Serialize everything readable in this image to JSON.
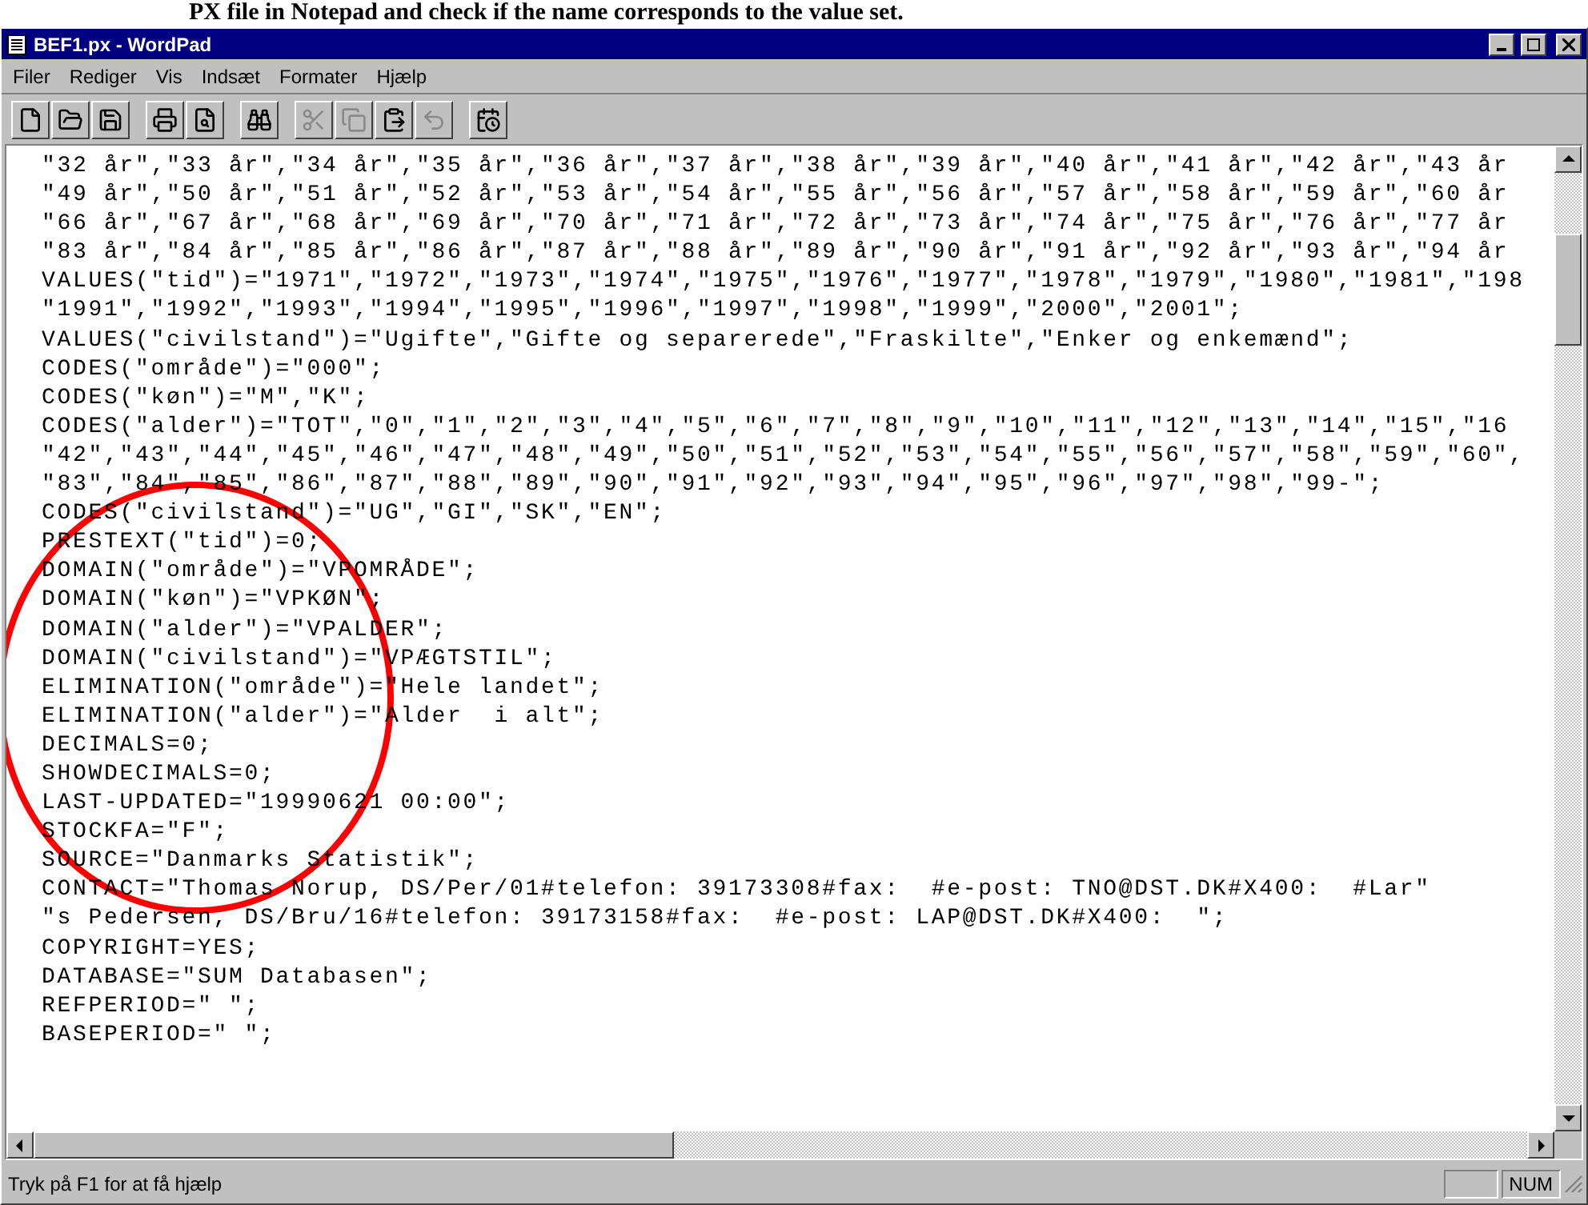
{
  "caption": "PX file in Notepad and check if the name corresponds to the value set.",
  "window": {
    "title": "BEF1.px - WordPad"
  },
  "menu": [
    {
      "label": "Filer"
    },
    {
      "label": "Rediger"
    },
    {
      "label": "Vis"
    },
    {
      "label": "Indsæt"
    },
    {
      "label": "Formater"
    },
    {
      "label": "Hjælp"
    }
  ],
  "toolbar": [
    {
      "kind": "new",
      "disabled": false
    },
    {
      "kind": "open",
      "disabled": false
    },
    {
      "kind": "save",
      "disabled": false
    },
    {
      "kind": "sep"
    },
    {
      "kind": "print",
      "disabled": false
    },
    {
      "kind": "preview",
      "disabled": false
    },
    {
      "kind": "sep"
    },
    {
      "kind": "find",
      "disabled": false
    },
    {
      "kind": "sep"
    },
    {
      "kind": "cut",
      "disabled": true
    },
    {
      "kind": "copy",
      "disabled": true
    },
    {
      "kind": "paste",
      "disabled": false
    },
    {
      "kind": "undo",
      "disabled": true
    },
    {
      "kind": "sep"
    },
    {
      "kind": "datetime",
      "disabled": false
    }
  ],
  "document": {
    "lines": [
      "\"32 år\",\"33 år\",\"34 år\",\"35 år\",\"36 år\",\"37 år\",\"38 år\",\"39 år\",\"40 år\",\"41 år\",\"42 år\",\"43 år",
      "\"49 år\",\"50 år\",\"51 år\",\"52 år\",\"53 år\",\"54 år\",\"55 år\",\"56 år\",\"57 år\",\"58 år\",\"59 år\",\"60 år",
      "\"66 år\",\"67 år\",\"68 år\",\"69 år\",\"70 år\",\"71 år\",\"72 år\",\"73 år\",\"74 år\",\"75 år\",\"76 år\",\"77 år",
      "\"83 år\",\"84 år\",\"85 år\",\"86 år\",\"87 år\",\"88 år\",\"89 år\",\"90 år\",\"91 år\",\"92 år\",\"93 år\",\"94 år",
      "VALUES(\"tid\")=\"1971\",\"1972\",\"1973\",\"1974\",\"1975\",\"1976\",\"1977\",\"1978\",\"1979\",\"1980\",\"1981\",\"198",
      "\"1991\",\"1992\",\"1993\",\"1994\",\"1995\",\"1996\",\"1997\",\"1998\",\"1999\",\"2000\",\"2001\";",
      "VALUES(\"civilstand\")=\"Ugifte\",\"Gifte og separerede\",\"Fraskilte\",\"Enker og enkemænd\";",
      "CODES(\"område\")=\"000\";",
      "CODES(\"køn\")=\"M\",\"K\";",
      "CODES(\"alder\")=\"TOT\",\"0\",\"1\",\"2\",\"3\",\"4\",\"5\",\"6\",\"7\",\"8\",\"9\",\"10\",\"11\",\"12\",\"13\",\"14\",\"15\",\"16",
      "\"42\",\"43\",\"44\",\"45\",\"46\",\"47\",\"48\",\"49\",\"50\",\"51\",\"52\",\"53\",\"54\",\"55\",\"56\",\"57\",\"58\",\"59\",\"60\",",
      "\"83\",\"84\",\"85\",\"86\",\"87\",\"88\",\"89\",\"90\",\"91\",\"92\",\"93\",\"94\",\"95\",\"96\",\"97\",\"98\",\"99-\";",
      "CODES(\"civilstand\")=\"UG\",\"GI\",\"SK\",\"EN\";",
      "PRESTEXT(\"tid\")=0;",
      "DOMAIN(\"område\")=\"VPOMRÅDE\";",
      "DOMAIN(\"køn\")=\"VPKØN\";",
      "DOMAIN(\"alder\")=\"VPALDER\";",
      "DOMAIN(\"civilstand\")=\"VPÆGTSTIL\";",
      "ELIMINATION(\"område\")=\"Hele landet\";",
      "ELIMINATION(\"alder\")=\"Alder  i alt\";",
      "DECIMALS=0;",
      "SHOWDECIMALS=0;",
      "LAST-UPDATED=\"19990621 00:00\";",
      "STOCKFA=\"F\";",
      "SOURCE=\"Danmarks Statistik\";",
      "CONTACT=\"Thomas Norup, DS/Per/01#telefon: 39173308#fax:  #e-post: TNO@DST.DK#X400:  #Lar\"",
      "\"s Pedersen, DS/Bru/16#telefon: 39173158#fax:  #e-post: LAP@DST.DK#X400:  \";",
      "COPYRIGHT=YES;",
      "DATABASE=\"SUM Databasen\";",
      "REFPERIOD=\" \";",
      "BASEPERIOD=\" \";"
    ]
  },
  "status_bar": {
    "text": "Tryk på F1 for at få hjælp",
    "indicator": "NUM"
  }
}
